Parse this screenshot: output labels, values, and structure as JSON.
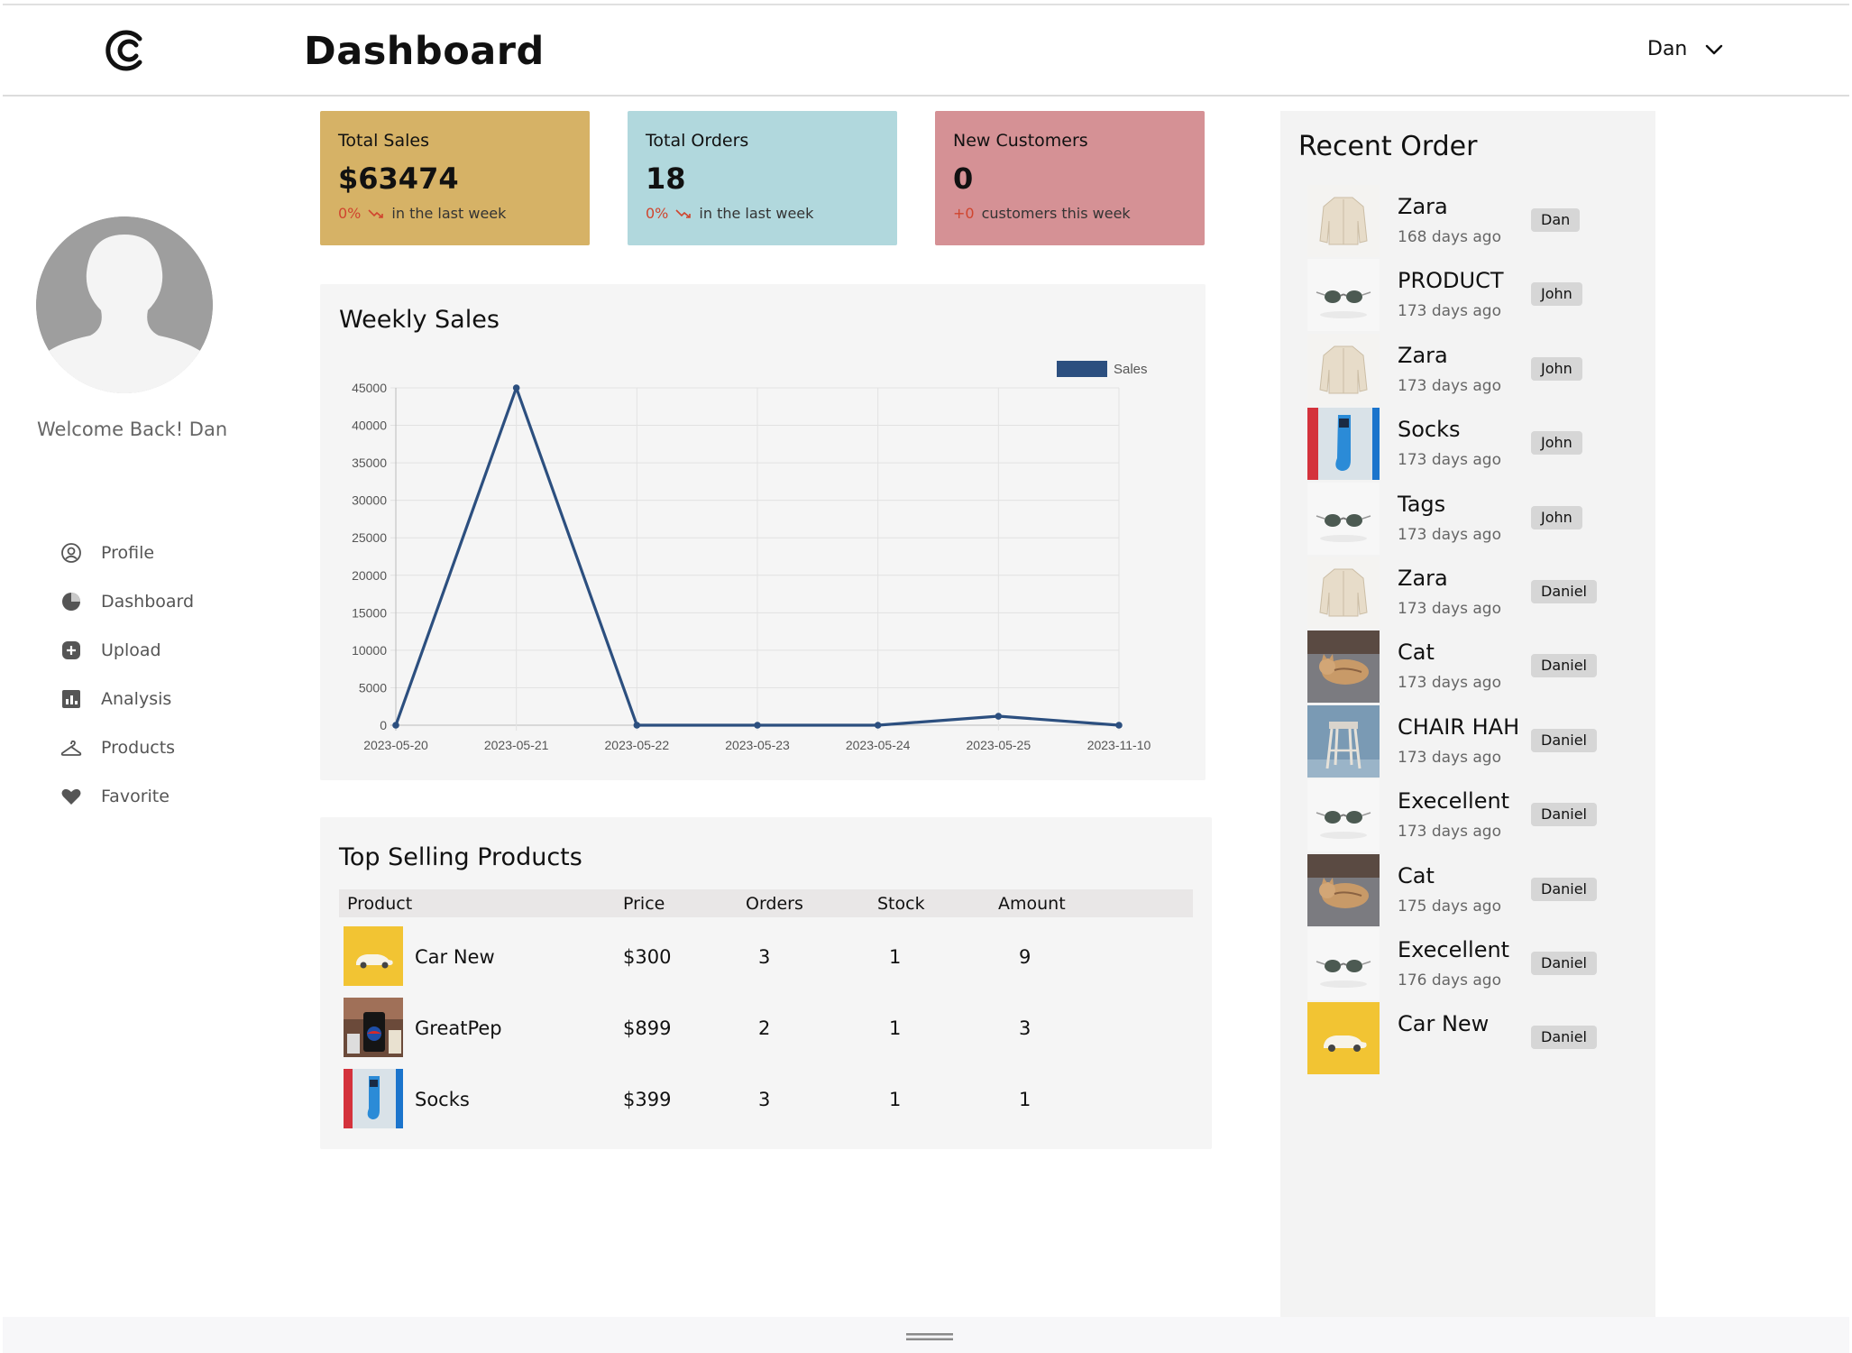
{
  "header": {
    "title": "Dashboard",
    "user_name": "Dan",
    "icons": [
      "logo-c-icon",
      "chevron-down-icon"
    ]
  },
  "sidebar": {
    "welcome": "Welcome Back! Dan",
    "items": [
      {
        "label": "Profile",
        "icon": "user-circle-icon"
      },
      {
        "label": "Dashboard",
        "icon": "pie-chart-icon"
      },
      {
        "label": "Upload",
        "icon": "plus-square-icon"
      },
      {
        "label": "Analysis",
        "icon": "bar-chart-icon"
      },
      {
        "label": "Products",
        "icon": "hanger-icon"
      },
      {
        "label": "Favorite",
        "icon": "heart-icon"
      }
    ]
  },
  "stats": [
    {
      "title": "Total Sales",
      "value": "$63474",
      "pct": "0%",
      "sub": "in the last week",
      "color": "#d6b266"
    },
    {
      "title": "Total Orders",
      "value": "18",
      "pct": "0%",
      "sub": "in the last week",
      "color": "#b1d8dd"
    },
    {
      "title": "New Customers",
      "value": "0",
      "pct": "+0",
      "sub": "customers this week",
      "color": "#d59195"
    }
  ],
  "chart_data": {
    "type": "line",
    "title": "Weekly Sales",
    "categories": [
      "2023-05-20",
      "2023-05-21",
      "2023-05-22",
      "2023-05-23",
      "2023-05-24",
      "2023-05-25",
      "2023-11-10"
    ],
    "series": [
      {
        "name": "Sales",
        "values": [
          0,
          45000,
          0,
          0,
          0,
          1200,
          0
        ],
        "color": "#2c4f7f"
      }
    ],
    "y_ticks": [
      "0",
      "5000",
      "10000",
      "15000",
      "20000",
      "25000",
      "30000",
      "35000",
      "40000",
      "45000"
    ],
    "ylim": [
      0,
      45000
    ],
    "grid": true,
    "legend": "top-right"
  },
  "top_selling": {
    "title": "Top Selling Products",
    "columns": [
      "Product",
      "Price",
      "Orders",
      "Stock",
      "Amount"
    ],
    "rows": [
      {
        "product": "Car New",
        "price": "$300",
        "orders": "3",
        "stock": "1",
        "amount": "9",
        "thumb": "car"
      },
      {
        "product": "GreatPep",
        "price": "$899",
        "orders": "2",
        "stock": "1",
        "amount": "3",
        "thumb": "pepsi"
      },
      {
        "product": "Socks",
        "price": "$399",
        "orders": "3",
        "stock": "1",
        "amount": "1",
        "thumb": "socks"
      }
    ]
  },
  "recent_orders": {
    "title": "Recent Order",
    "items": [
      {
        "name": "Zara",
        "time": "168 days ago",
        "user": "Dan",
        "thumb": "jacket"
      },
      {
        "name": "PRODUCT",
        "time": "173 days ago",
        "user": "John",
        "thumb": "sunglasses"
      },
      {
        "name": "Zara",
        "time": "173 days ago",
        "user": "John",
        "thumb": "jacket"
      },
      {
        "name": "Socks",
        "time": "173 days ago",
        "user": "John",
        "thumb": "socks"
      },
      {
        "name": "Tags",
        "time": "173 days ago",
        "user": "John",
        "thumb": "sunglasses"
      },
      {
        "name": "Zara",
        "time": "173 days ago",
        "user": "Daniel",
        "thumb": "jacket"
      },
      {
        "name": "Cat",
        "time": "173 days ago",
        "user": "Daniel",
        "thumb": "cat"
      },
      {
        "name": "CHAIR HAH",
        "time": "173 days ago",
        "user": "Daniel",
        "thumb": "stool"
      },
      {
        "name": "Execellent",
        "time": "173 days ago",
        "user": "Daniel",
        "thumb": "sunglasses"
      },
      {
        "name": "Cat",
        "time": "175 days ago",
        "user": "Daniel",
        "thumb": "cat"
      },
      {
        "name": "Execellent",
        "time": "176 days ago",
        "user": "Daniel",
        "thumb": "sunglasses"
      },
      {
        "name": "Car New",
        "time": "",
        "user": "Daniel",
        "thumb": "car"
      }
    ]
  }
}
